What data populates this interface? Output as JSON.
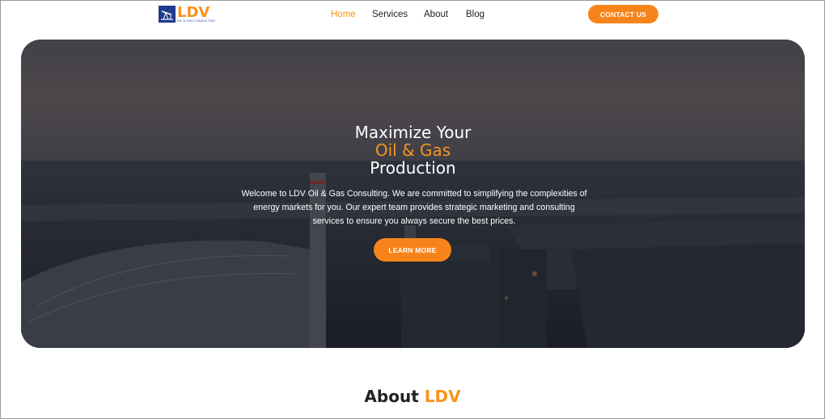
{
  "brand": {
    "name": "LDV",
    "tagline": "OIL & GAS CONSULTING"
  },
  "nav": {
    "items": [
      {
        "label": "Home",
        "active": true
      },
      {
        "label": "Services",
        "active": false
      },
      {
        "label": "About",
        "active": false
      },
      {
        "label": "Blog",
        "active": false
      }
    ],
    "contact_label": "CONTACT US"
  },
  "hero": {
    "title_line1": "Maximize Your",
    "title_line2": "Oil & Gas",
    "title_line3": "Production",
    "description": "Welcome to LDV Oil & Gas Consulting. We are committed to simplifying the complexities of energy markets for you. Our expert team provides strategic marketing and consulting services to ensure you always secure the best prices.",
    "cta_label": "LEARN MORE"
  },
  "about": {
    "heading_prefix": "About",
    "heading_accent": "LDV"
  },
  "colors": {
    "accent": "#f7941d",
    "brand_blue": "#1f3a8f",
    "text": "#222222"
  }
}
